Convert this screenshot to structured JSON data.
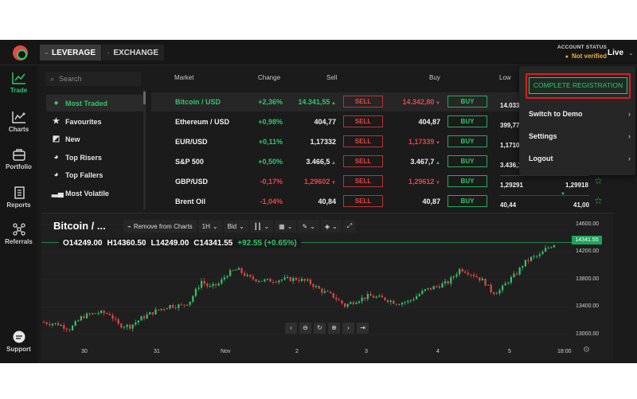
{
  "topbar": {
    "leverage_label": "LEVERAGE",
    "exchange_label": "EXCHANGE",
    "account_status_label": "ACCOUNT STATUS",
    "account_status_value": "Not verified",
    "mode": "Live"
  },
  "sidebar": {
    "items": [
      {
        "label": "Trade",
        "icon": "trade-chart-icon"
      },
      {
        "label": "Charts",
        "icon": "charts-icon"
      },
      {
        "label": "Portfolio",
        "icon": "briefcase-icon"
      },
      {
        "label": "Reports",
        "icon": "document-icon"
      },
      {
        "label": "Referrals",
        "icon": "network-icon"
      },
      {
        "label": "Support",
        "icon": "chat-bubble-icon"
      }
    ]
  },
  "market_list": {
    "search_placeholder": "Search",
    "categories": [
      {
        "label": "Most Traded",
        "icon": "flame-icon"
      },
      {
        "label": "Favourites",
        "icon": "star-icon"
      },
      {
        "label": "New",
        "icon": "new-icon"
      },
      {
        "label": "Top Risers",
        "icon": "rise-icon"
      },
      {
        "label": "Top Fallers",
        "icon": "fall-icon"
      },
      {
        "label": "Most Volatile",
        "icon": "volatility-icon"
      }
    ]
  },
  "table": {
    "headers": {
      "market": "Market",
      "change": "Change",
      "sell": "Sell",
      "buy": "Buy",
      "low": "Low"
    },
    "sell_label": "SELL",
    "buy_label": "BUY",
    "rows": [
      {
        "market": "Bitcoin / USD",
        "change": "+2,36%",
        "sell": "14.341,55",
        "buy": "14.342,80",
        "low": "14.033,"
      },
      {
        "market": "Ethereum / USD",
        "change": "+0,98%",
        "sell": "404,77",
        "buy": "404,87",
        "low": "399,77"
      },
      {
        "market": "EUR/USD",
        "change": "+0,11%",
        "sell": "1,17332",
        "buy": "1,17339",
        "low": "1,1710"
      },
      {
        "market": "S&P 500",
        "change": "+0,50%",
        "sell": "3.466,5",
        "buy": "3.467,7",
        "low": "3.436,1"
      },
      {
        "market": "GBP/USD",
        "change": "-0,17%",
        "sell": "1,29602",
        "buy": "1,29612",
        "low": "1,29291",
        "high": "1,29918"
      },
      {
        "market": "Brent Oil",
        "change": "-1,04%",
        "sell": "40,84",
        "buy": "40,87",
        "low": "40,44",
        "high": "41,00"
      }
    ]
  },
  "dropdown": {
    "complete_registration": "COMPLETE REGISTRATION",
    "items": [
      "Switch to Demo",
      "Settings",
      "Logout"
    ]
  },
  "chart": {
    "title": "Bitcoin / ...",
    "remove_label": "Remove from Charts",
    "interval": "1H",
    "price_type": "Bid",
    "ohlc": {
      "o_label": "O",
      "o": "14249.00",
      "h_label": "H",
      "h": "14360.50",
      "l_label": "L",
      "l": "14249.00",
      "c_label": "C",
      "c": "14341.55",
      "change": "+92.55 (+0.65%)"
    },
    "price_tag": "14341.55",
    "y_labels": [
      "14600.00",
      "14200.00",
      "13800.00",
      "13400.00",
      "13000.00"
    ],
    "x_labels": [
      "30",
      "31",
      "Nov",
      "2",
      "3",
      "4",
      "5",
      "18:00"
    ],
    "colors": {
      "up": "#33c46a",
      "down": "#e64646"
    }
  }
}
